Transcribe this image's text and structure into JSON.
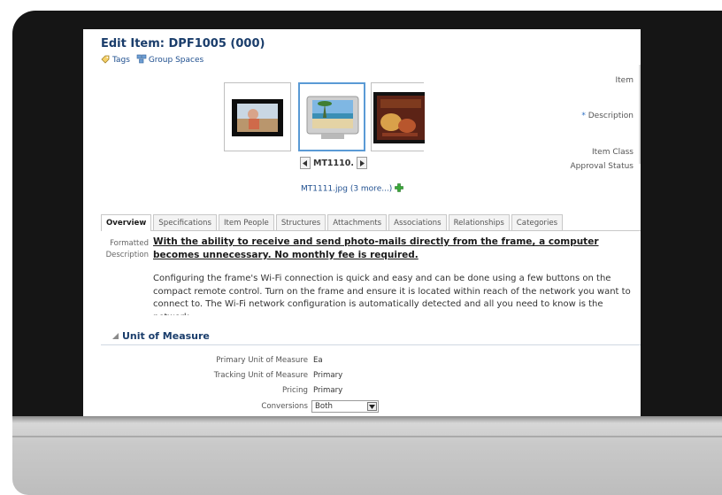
{
  "header": {
    "title": "Edit Item: DPF1005 (000)",
    "tags_link": "Tags",
    "group_spaces_link": "Group Spaces"
  },
  "gallery": {
    "thumbnail_label": "MT1110.",
    "file_link": "MT1111.jpg (3 more...)",
    "selected_index": 1
  },
  "summary": {
    "item_label": "Item",
    "description_required_mark": "*",
    "description_label": "Description",
    "item_class_label": "Item Class",
    "approval_status_label": "Approval Status"
  },
  "tabs": [
    {
      "label": "Overview",
      "active": true
    },
    {
      "label": "Specifications",
      "active": false
    },
    {
      "label": "Item People",
      "active": false
    },
    {
      "label": "Structures",
      "active": false
    },
    {
      "label": "Attachments",
      "active": false
    },
    {
      "label": "Associations",
      "active": false
    },
    {
      "label": "Relationships",
      "active": false
    },
    {
      "label": "Categories",
      "active": false
    }
  ],
  "overview": {
    "formatted_description_label_1": "Formatted",
    "formatted_description_label_2": "Description",
    "headline": "With the ability to receive and send photo-mails directly from the frame, a computer becomes unnecessary. No monthly fee is required.",
    "body": "Configuring the frame's Wi-Fi connection is quick and easy and can be done using a few buttons on the compact remote control. Turn on the frame and ensure it is located within reach of the network you want to connect to. The Wi-Fi network configuration is automatically detected and all you need to know is the network"
  },
  "unit_of_measure": {
    "section_title": "Unit of Measure",
    "rows": [
      {
        "label": "Primary Unit of Measure",
        "value": "Ea"
      },
      {
        "label": "Tracking Unit of Measure",
        "value": "Primary"
      },
      {
        "label": "Pricing",
        "value": "Primary"
      },
      {
        "label": "Conversions",
        "value": "Both"
      }
    ]
  },
  "colors": {
    "title": "#1a3d6b",
    "link": "#1f4f8f",
    "selected_border": "#5a9ad5",
    "add_icon": "#3aa83a"
  },
  "icons": {
    "tags": "tag-icon",
    "group_spaces": "group-spaces-icon",
    "pager_prev": "triangle-left-icon",
    "pager_next": "triangle-right-icon",
    "add": "green-plus-icon",
    "section": "collapse-triangle-icon",
    "select": "chevron-down-icon"
  }
}
